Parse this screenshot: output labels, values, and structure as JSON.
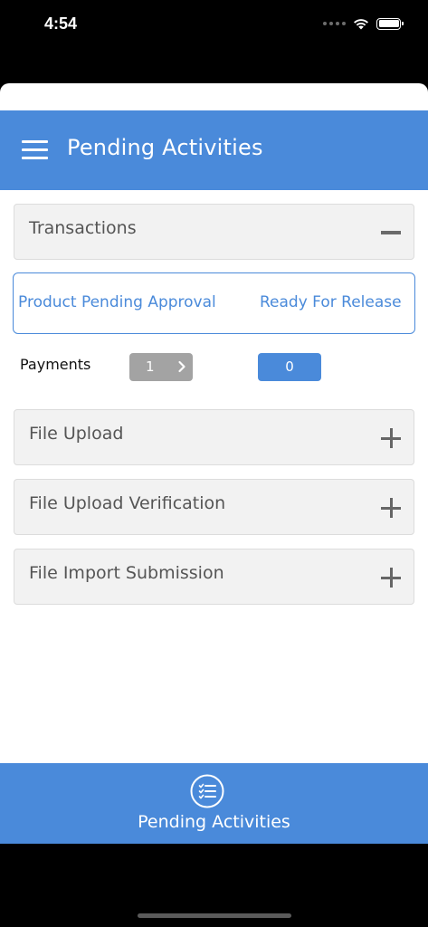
{
  "status_bar": {
    "time": "4:54"
  },
  "header": {
    "title": "Pending Activities"
  },
  "sections": {
    "transactions": {
      "label": "Transactions",
      "expanded": true
    },
    "file_upload": {
      "label": "File Upload",
      "expanded": false
    },
    "file_upload_verification": {
      "label": "File Upload Verification",
      "expanded": false
    },
    "file_import_submission": {
      "label": "File Import Submission",
      "expanded": false
    }
  },
  "tabs": {
    "product_pending_approval": "Product Pending Approval",
    "ready_for_release": "Ready For Release"
  },
  "payments": {
    "label": "Payments",
    "pending_count": "1",
    "release_count": "0"
  },
  "bottom_nav": {
    "label": "Pending Activities"
  },
  "colors": {
    "accent": "#4a8ada",
    "section_bg": "#f2f2f2",
    "pill_grey": "#a3a3a3"
  },
  "icons": [
    "hamburger-icon",
    "minus-icon",
    "plus-icon",
    "chevron-right-icon",
    "checklist-icon",
    "wifi-icon",
    "battery-icon"
  ]
}
